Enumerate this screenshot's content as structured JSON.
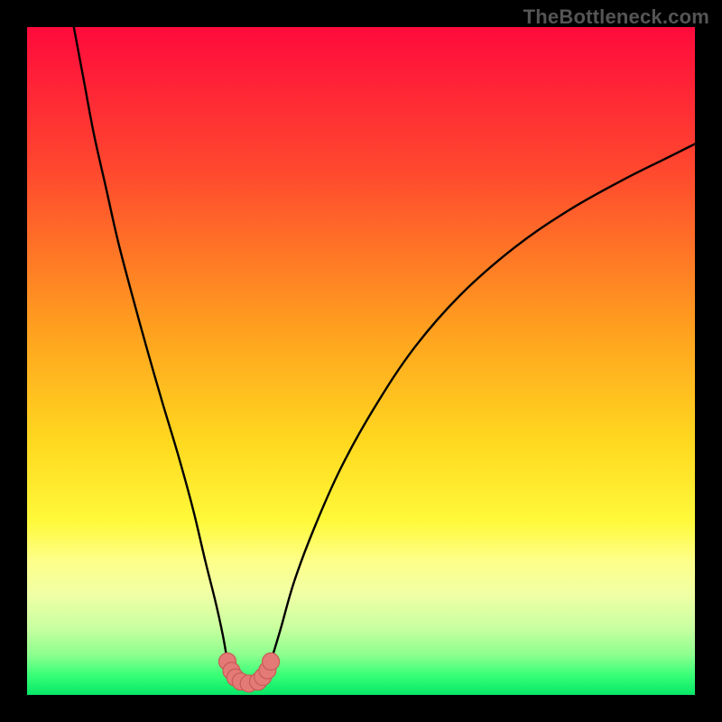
{
  "watermark": "TheBottleneck.com",
  "chart_data": {
    "type": "line",
    "title": "",
    "xlabel": "",
    "ylabel": "",
    "xlim": [
      0,
      100
    ],
    "ylim": [
      0,
      100
    ],
    "grid": false,
    "legend": false,
    "gradient_stops": [
      {
        "offset": 0,
        "color": "#ff0a3c"
      },
      {
        "offset": 0.22,
        "color": "#ff4a2e"
      },
      {
        "offset": 0.45,
        "color": "#ff9f1f"
      },
      {
        "offset": 0.62,
        "color": "#ffd81f"
      },
      {
        "offset": 0.74,
        "color": "#fff93a"
      },
      {
        "offset": 0.8,
        "color": "#fdff8a"
      },
      {
        "offset": 0.85,
        "color": "#f0ffa5"
      },
      {
        "offset": 0.9,
        "color": "#c8ff9f"
      },
      {
        "offset": 0.94,
        "color": "#8dff8f"
      },
      {
        "offset": 0.97,
        "color": "#39ff77"
      },
      {
        "offset": 1.0,
        "color": "#07e768"
      }
    ],
    "curves": [
      {
        "name": "left-branch",
        "points": [
          {
            "x": 7.0,
            "y": 100.0
          },
          {
            "x": 8.5,
            "y": 92.0
          },
          {
            "x": 10.0,
            "y": 84.0
          },
          {
            "x": 11.8,
            "y": 76.0
          },
          {
            "x": 13.6,
            "y": 68.0
          },
          {
            "x": 15.7,
            "y": 60.0
          },
          {
            "x": 17.9,
            "y": 52.0
          },
          {
            "x": 20.2,
            "y": 44.0
          },
          {
            "x": 22.6,
            "y": 36.0
          },
          {
            "x": 24.8,
            "y": 28.0
          },
          {
            "x": 26.7,
            "y": 20.0
          },
          {
            "x": 28.2,
            "y": 14.0
          },
          {
            "x": 29.3,
            "y": 9.0
          },
          {
            "x": 30.0,
            "y": 5.0
          }
        ]
      },
      {
        "name": "right-branch",
        "points": [
          {
            "x": 36.5,
            "y": 5.0
          },
          {
            "x": 38.0,
            "y": 10.0
          },
          {
            "x": 40.0,
            "y": 17.0
          },
          {
            "x": 43.0,
            "y": 25.0
          },
          {
            "x": 47.0,
            "y": 34.0
          },
          {
            "x": 52.0,
            "y": 43.0
          },
          {
            "x": 58.0,
            "y": 52.0
          },
          {
            "x": 65.0,
            "y": 60.0
          },
          {
            "x": 73.0,
            "y": 67.0
          },
          {
            "x": 81.0,
            "y": 72.5
          },
          {
            "x": 89.0,
            "y": 77.0
          },
          {
            "x": 96.0,
            "y": 80.5
          },
          {
            "x": 100.0,
            "y": 82.5
          }
        ]
      }
    ],
    "boundary_markers": [
      {
        "x": 30.0,
        "y": 5.0
      },
      {
        "x": 30.6,
        "y": 3.6
      },
      {
        "x": 31.2,
        "y": 2.6
      },
      {
        "x": 32.0,
        "y": 2.0
      },
      {
        "x": 33.2,
        "y": 1.7
      },
      {
        "x": 34.6,
        "y": 2.0
      },
      {
        "x": 35.3,
        "y": 2.7
      },
      {
        "x": 36.0,
        "y": 3.7
      },
      {
        "x": 36.5,
        "y": 5.0
      }
    ],
    "marker_style": {
      "radius_px": 9.5,
      "fill": "#e47a76",
      "stroke": "#c85a56",
      "stroke_width": 1.2
    }
  }
}
